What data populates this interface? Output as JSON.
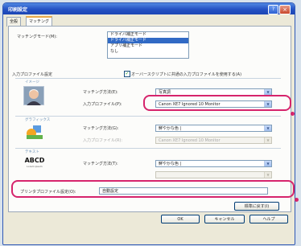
{
  "window": {
    "title": "印刷設定",
    "help_glyph": "?",
    "close_glyph": "×"
  },
  "tabs": [
    {
      "label": "全般"
    },
    {
      "label": "マッチング"
    }
  ],
  "matching_mode": {
    "label": "マッチングモード(M):",
    "options": [
      "ドライバ補正モード",
      "ドライバ補正モード",
      "アプリ補正モード",
      "なし"
    ],
    "selected_index": 1
  },
  "std_profile": {
    "checkbox_label": "オーバースクリプトに共通の入力プロファイルを使用する(A)",
    "checked": true,
    "check_glyph": "✓",
    "section_label": "入力プロファイル設定"
  },
  "groups": {
    "photo": {
      "group_label": "イメージ",
      "method_label": "マッチング方法(E):",
      "method_value": "写真調",
      "profile_label": "入力プロファイル(P):",
      "profile_value": "Canon XE7 Ignored 10 Monitor"
    },
    "graphics": {
      "group_label": "グラフィックス",
      "method_label": "マッチング方法(G):",
      "method_value": "鮮やかな色 |",
      "profile_label": "入力プロファイル(R):",
      "profile_value": "Canon XE7 Ignored 10 Monitor"
    },
    "text": {
      "group_label": "テキスト",
      "method_label": "マッチング方法(T):",
      "method_value": "鮮やかな色 |",
      "icon_text": "ABCD",
      "icon_subtext": "Lorem ipsum"
    }
  },
  "printer_profile": {
    "label": "プリンタプロファイル設定(O):",
    "value": "自動設定"
  },
  "buttons": {
    "defaults": "標準に戻す(I)",
    "ok": "OK",
    "cancel": "キャンセル",
    "help": "ヘルプ"
  },
  "colors": {
    "annotation": "#d6246c",
    "selection": "#316ac5",
    "titlebar": "#2451c3"
  },
  "icons": {
    "photo": "portrait-photo-icon",
    "graphics": "graphics-shapes-icon",
    "text": "text-abcd-icon",
    "dropdown": "dropdown-arrow-icon"
  }
}
